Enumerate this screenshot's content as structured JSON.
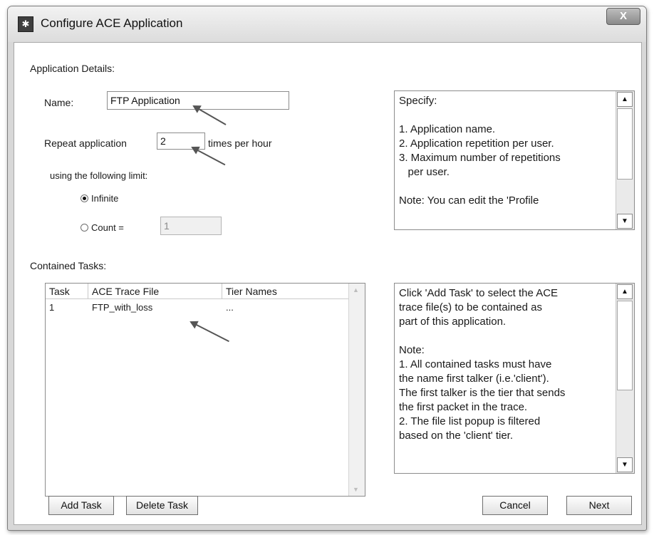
{
  "window": {
    "title": "Configure ACE Application",
    "close_label": "X"
  },
  "details": {
    "section_label": "Application Details:",
    "name_label": "Name:",
    "name_value": "FTP Application",
    "repeat_label": "Repeat application",
    "repeat_value": "2",
    "repeat_suffix": "times per hour",
    "limit_label": "using the following limit:",
    "infinite_label": "Infinite",
    "count_label": "Count =",
    "count_value": "1",
    "selected_limit": "Infinite"
  },
  "details_help": {
    "text": "Specify:\n\n1. Application name.\n2. Application repetition per user.\n3. Maximum number of repetitions\n   per user.\n\nNote: You can edit the 'Profile"
  },
  "tasks": {
    "section_label": "Contained Tasks:",
    "columns": [
      "Task",
      "ACE Trace File",
      "Tier Names"
    ],
    "rows": [
      {
        "task": "1",
        "trace_file": "FTP_with_loss",
        "tier_names": "..."
      }
    ]
  },
  "tasks_help": {
    "text": "Click 'Add Task' to select the ACE\ntrace file(s) to be contained as\npart of this application.\n\nNote:\n1. All contained tasks must have\nthe name first talker (i.e.'client').\nThe first talker is the tier that sends\nthe first packet in the trace.\n2. The file list popup is filtered\nbased on the 'client' tier."
  },
  "buttons": {
    "add_task": "Add Task",
    "delete_task": "Delete Task",
    "cancel": "Cancel",
    "next": "Next"
  },
  "icons": {
    "scroll_up": "▲",
    "scroll_down": "▼",
    "app_icon": "✱"
  }
}
